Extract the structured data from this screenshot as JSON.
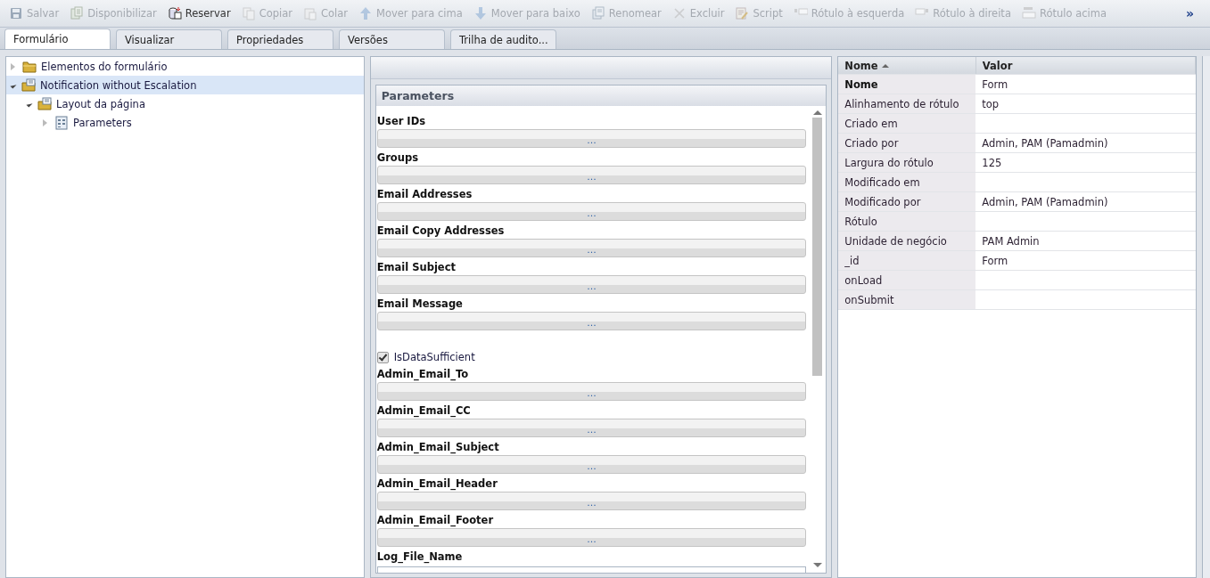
{
  "toolbar": [
    {
      "label": "Salvar",
      "disabled": true
    },
    {
      "label": "Disponibilizar",
      "disabled": true
    },
    {
      "label": "Reservar",
      "disabled": false
    },
    {
      "label": "Copiar",
      "disabled": true
    },
    {
      "label": "Colar",
      "disabled": true
    },
    {
      "label": "Mover para cima",
      "disabled": true
    },
    {
      "label": "Mover para baixo",
      "disabled": true
    },
    {
      "label": "Renomear",
      "disabled": true
    },
    {
      "label": "Excluir",
      "disabled": true
    },
    {
      "label": "Script",
      "disabled": true
    },
    {
      "label": "Rótulo à esquerda",
      "disabled": true
    },
    {
      "label": "Rótulo à direita",
      "disabled": true
    },
    {
      "label": "Rótulo acima",
      "disabled": true
    }
  ],
  "toolbar_overflow": "»",
  "tabs": [
    {
      "label": "Formulário",
      "selected": true
    },
    {
      "label": "Visualizar",
      "selected": false
    },
    {
      "label": "Propriedades",
      "selected": false
    },
    {
      "label": "Versões",
      "selected": false
    },
    {
      "label": "Trilha de audito...",
      "selected": false
    }
  ],
  "tree": [
    {
      "label": "Elementos do formulário",
      "kind": "folder",
      "expanded": false,
      "selected": false
    },
    {
      "label": "Notification without Escalation",
      "kind": "form",
      "expanded": true,
      "selected": true,
      "children": [
        {
          "label": "Layout da página",
          "kind": "form",
          "expanded": true,
          "selected": false,
          "children": [
            {
              "label": "Parameters",
              "kind": "grid",
              "expanded": false,
              "selected": false
            }
          ]
        }
      ]
    }
  ],
  "form_panel": {
    "title": "Parameters",
    "fields": [
      {
        "kind": "lookup",
        "label": "User IDs",
        "button": "..."
      },
      {
        "kind": "lookup",
        "label": "Groups",
        "button": "..."
      },
      {
        "kind": "lookup",
        "label": "Email Addresses",
        "button": "..."
      },
      {
        "kind": "lookup",
        "label": "Email Copy Addresses",
        "button": "..."
      },
      {
        "kind": "lookup",
        "label": "Email Subject",
        "button": "..."
      },
      {
        "kind": "lookup",
        "label": "Email Message",
        "button": "..."
      },
      {
        "kind": "checkbox",
        "label": "IsDataSufficient",
        "checked": true
      },
      {
        "kind": "lookup",
        "label": "Admin_Email_To",
        "button": "..."
      },
      {
        "kind": "lookup",
        "label": "Admin_Email_CC",
        "button": "..."
      },
      {
        "kind": "lookup",
        "label": "Admin_Email_Subject",
        "button": "..."
      },
      {
        "kind": "lookup",
        "label": "Admin_Email_Header",
        "button": "..."
      },
      {
        "kind": "lookup",
        "label": "Admin_Email_Footer",
        "button": "..."
      },
      {
        "kind": "text",
        "label": "Log_File_Name"
      }
    ]
  },
  "properties": {
    "columns": [
      {
        "label": "Nome",
        "sorted": true
      },
      {
        "label": "Valor",
        "sorted": false
      }
    ],
    "rows": [
      {
        "name": "Nome",
        "value": "Form",
        "bold": true
      },
      {
        "name": "Alinhamento de rótulo",
        "value": "top",
        "bold": false
      },
      {
        "name": "Criado em",
        "bold": false
      },
      {
        "name": "Criado por",
        "value": "Admin, PAM (Pamadmin)",
        "bold": false
      },
      {
        "name": "Largura do rótulo",
        "value": "125",
        "bold": false
      },
      {
        "name": "Modificado em",
        "bold": false
      },
      {
        "name": "Modificado por",
        "value": "Admin, PAM (Pamadmin)",
        "bold": false
      },
      {
        "name": "Rótulo",
        "bold": false
      },
      {
        "name": "Unidade de negócio",
        "value": "PAM Admin",
        "bold": false
      },
      {
        "name": "_id",
        "value": "Form",
        "bold": false
      },
      {
        "name": "onLoad",
        "bold": false
      },
      {
        "name": "onSubmit",
        "bold": false
      }
    ]
  }
}
